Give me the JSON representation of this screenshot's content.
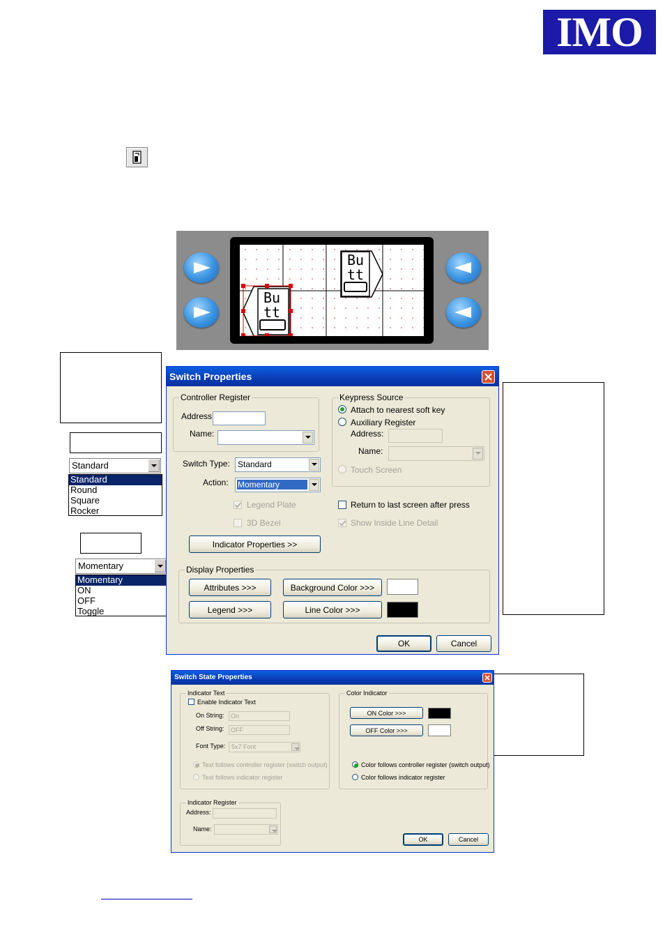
{
  "logo": {
    "text": "IMO"
  },
  "preview": {
    "button_label_top": "Bu",
    "button_label_bottom": "tt"
  },
  "style_dropdown": {
    "selected": "Standard",
    "options": [
      "Standard",
      "Round",
      "Square",
      "Rocker"
    ]
  },
  "action_dropdown": {
    "selected": "Momentary",
    "options": [
      "Momentary",
      "ON",
      "OFF",
      "Toggle"
    ]
  },
  "switch_properties": {
    "title": "Switch Properties",
    "controller_register": {
      "legend": "Controller Register",
      "address_label": "Address:",
      "address_value": "",
      "name_label": "Name:",
      "name_value": ""
    },
    "switch_type_label": "Switch Type:",
    "switch_type_value": "Standard",
    "action_label": "Action:",
    "action_value": "Momentary",
    "legend_plate": "Legend Plate",
    "bezel_3d": "3D Bezel",
    "indicator_properties_button": "Indicator Properties >>",
    "keypress_source": {
      "legend": "Keypress Source",
      "attach_soft_key": "Attach to nearest soft key",
      "auxiliary_register": "Auxiliary Register",
      "address_label": "Address:",
      "name_label": "Name:",
      "touch_screen": "Touch Screen"
    },
    "return_last_screen": "Return to last screen after press",
    "show_inside_line": "Show Inside Line Detail",
    "display_properties": {
      "legend": "Display Properties",
      "attributes_button": "Attributes >>>",
      "background_color_button": "Background Color >>>",
      "legend_button": "Legend >>>",
      "line_color_button": "Line Color >>>",
      "background_color": "#ffffff",
      "line_color": "#000000"
    },
    "ok": "OK",
    "cancel": "Cancel"
  },
  "switch_state_properties": {
    "title": "Switch State Properties",
    "indicator_text": {
      "legend": "Indicator Text",
      "enable": "Enable Indicator Text",
      "on_string_label": "On String:",
      "on_string_value": "On",
      "off_string_label": "Off String:",
      "off_string_value": "OFF",
      "font_type_label": "Font Type:",
      "font_type_value": "5x7 Font",
      "follows_controller": "Text follows controller register (switch output)",
      "follows_indicator": "Text follows indicator register"
    },
    "color_indicator": {
      "legend": "Color Indicator",
      "on_color_button": "ON Color >>>",
      "off_color_button": "OFF Color >>>",
      "on_color": "#000000",
      "off_color": "#ffffff",
      "follows_controller": "Color follows controller register (switch output)",
      "follows_indicator": "Color follows indicator register"
    },
    "indicator_register": {
      "legend": "Indicator Register",
      "address_label": "Address:",
      "name_label": "Name:"
    },
    "ok": "OK",
    "cancel": "Cancel"
  }
}
